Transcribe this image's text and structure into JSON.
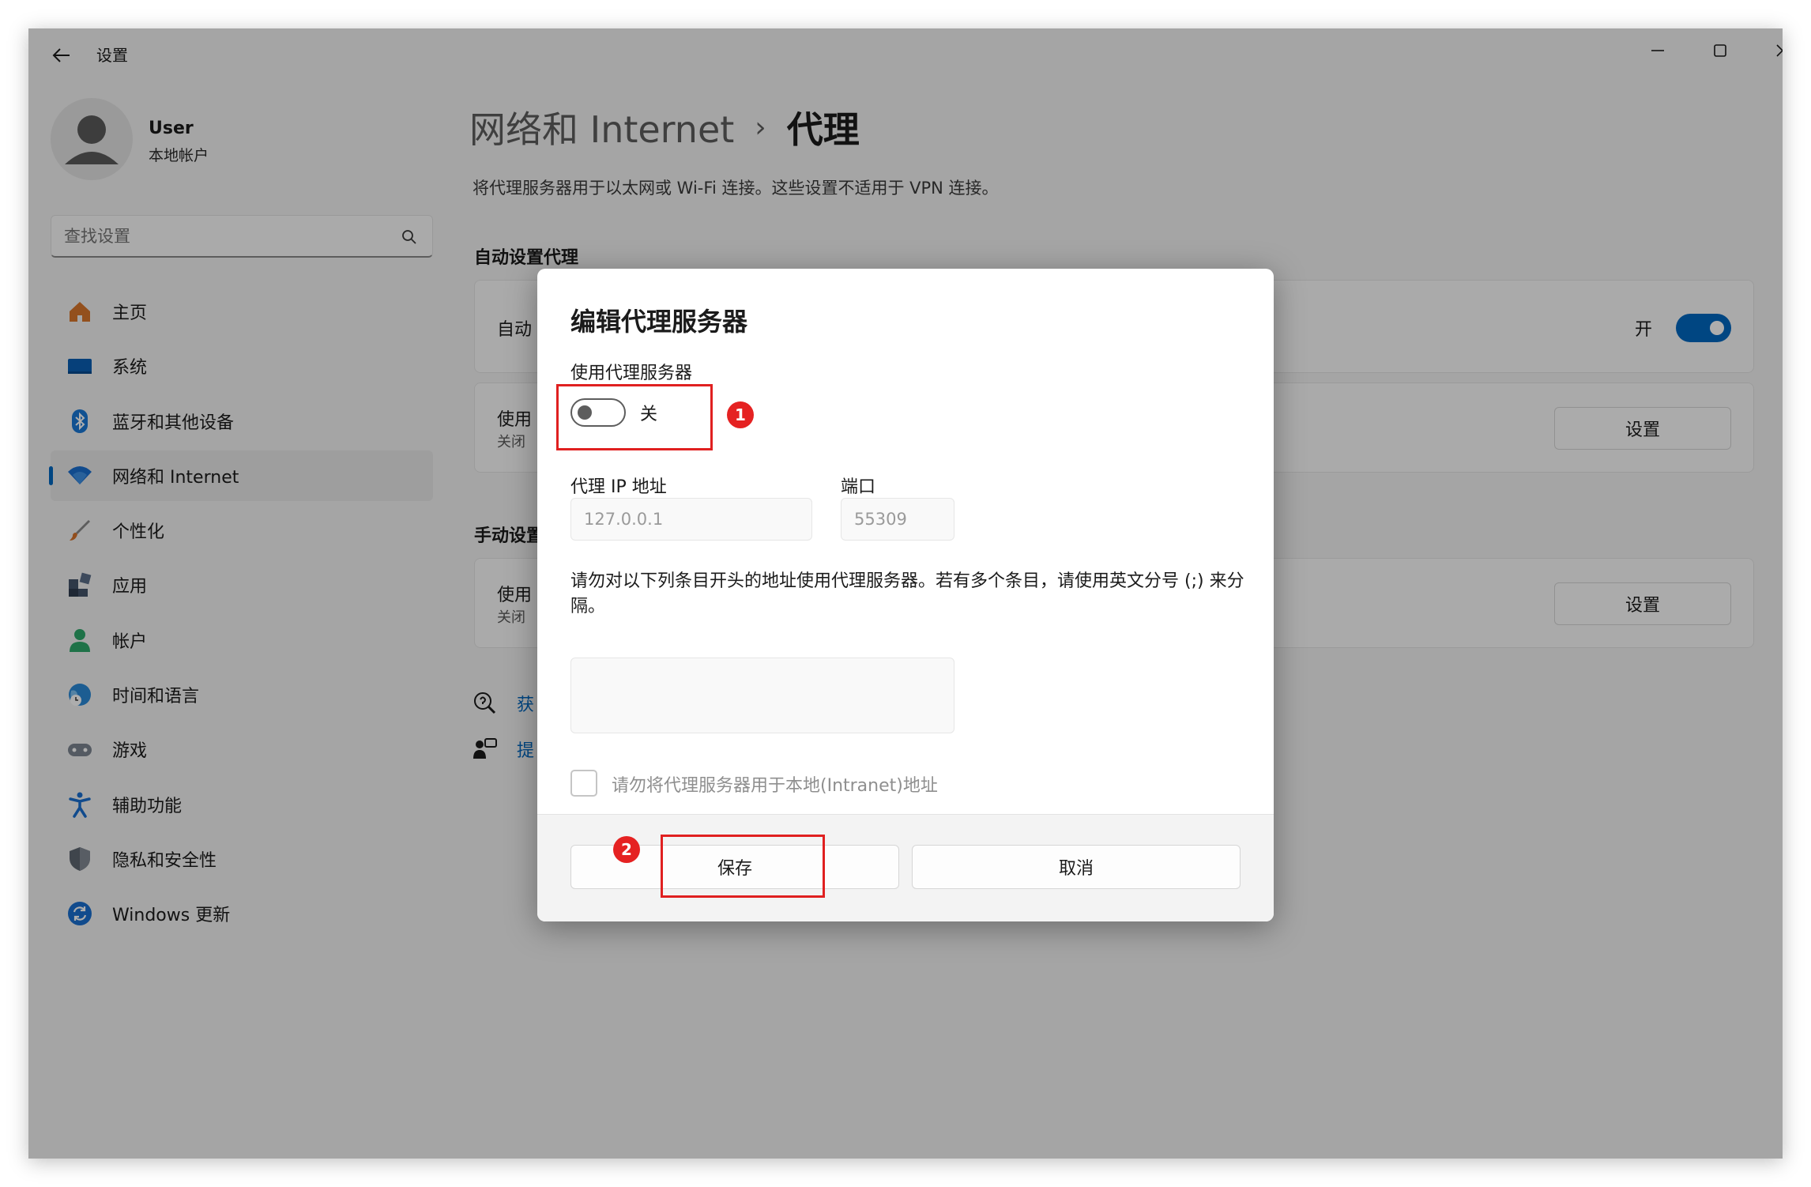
{
  "window": {
    "title": "设置",
    "controls": {
      "minimize": "minimize-icon",
      "maximize": "maximize-icon",
      "close": "close-icon"
    }
  },
  "user": {
    "name": "User",
    "account_type": "本地帐户"
  },
  "search": {
    "placeholder": "查找设置"
  },
  "sidebar": {
    "items": [
      {
        "label": "主页",
        "icon": "home-icon",
        "active": false
      },
      {
        "label": "系统",
        "icon": "system-icon",
        "active": false
      },
      {
        "label": "蓝牙和其他设备",
        "icon": "bluetooth-icon",
        "active": false
      },
      {
        "label": "网络和 Internet",
        "icon": "wifi-icon",
        "active": true
      },
      {
        "label": "个性化",
        "icon": "brush-icon",
        "active": false
      },
      {
        "label": "应用",
        "icon": "apps-icon",
        "active": false
      },
      {
        "label": "帐户",
        "icon": "account-icon",
        "active": false
      },
      {
        "label": "时间和语言",
        "icon": "time-language-icon",
        "active": false
      },
      {
        "label": "游戏",
        "icon": "gamepad-icon",
        "active": false
      },
      {
        "label": "辅助功能",
        "icon": "accessibility-icon",
        "active": false
      },
      {
        "label": "隐私和安全性",
        "icon": "shield-icon",
        "active": false
      },
      {
        "label": "Windows 更新",
        "icon": "update-icon",
        "active": false
      }
    ]
  },
  "main": {
    "breadcrumb_parent": "网络和 Internet",
    "breadcrumb_separator": "›",
    "breadcrumb_current": "代理",
    "description": "将代理服务器用于以太网或 Wi-Fi 连接。这些设置不适用于 VPN 连接。",
    "auto_section_title": "自动设置代理",
    "auto_card1": {
      "title": "自动",
      "toggle_label": "开",
      "toggle_state": "on"
    },
    "auto_card2": {
      "title": "使用",
      "subtitle": "关闭",
      "button": "设置"
    },
    "manual_section_title": "手动设置",
    "manual_card": {
      "title": "使用",
      "subtitle": "关闭",
      "button": "设置"
    },
    "links": [
      {
        "text": "获",
        "icon": "help-icon"
      },
      {
        "text": "提",
        "icon": "feedback-icon"
      }
    ]
  },
  "dialog": {
    "title": "编辑代理服务器",
    "use_proxy_label": "使用代理服务器",
    "toggle_label": "关",
    "toggle_state": "off",
    "ip_label": "代理 IP 地址",
    "ip_value": "127.0.0.1",
    "port_label": "端口",
    "port_value": "55309",
    "exceptions_desc": "请勿对以下列条目开头的地址使用代理服务器。若有多个条目，请使用英文分号 (;) 来分隔。",
    "exceptions_value": "",
    "local_checkbox_label": "请勿将代理服务器用于本地(Intranet)地址",
    "local_checkbox_checked": false,
    "save_button": "保存",
    "cancel_button": "取消"
  },
  "annotations": {
    "badge1": "1",
    "badge2": "2",
    "highlight_color": "#e02020"
  }
}
